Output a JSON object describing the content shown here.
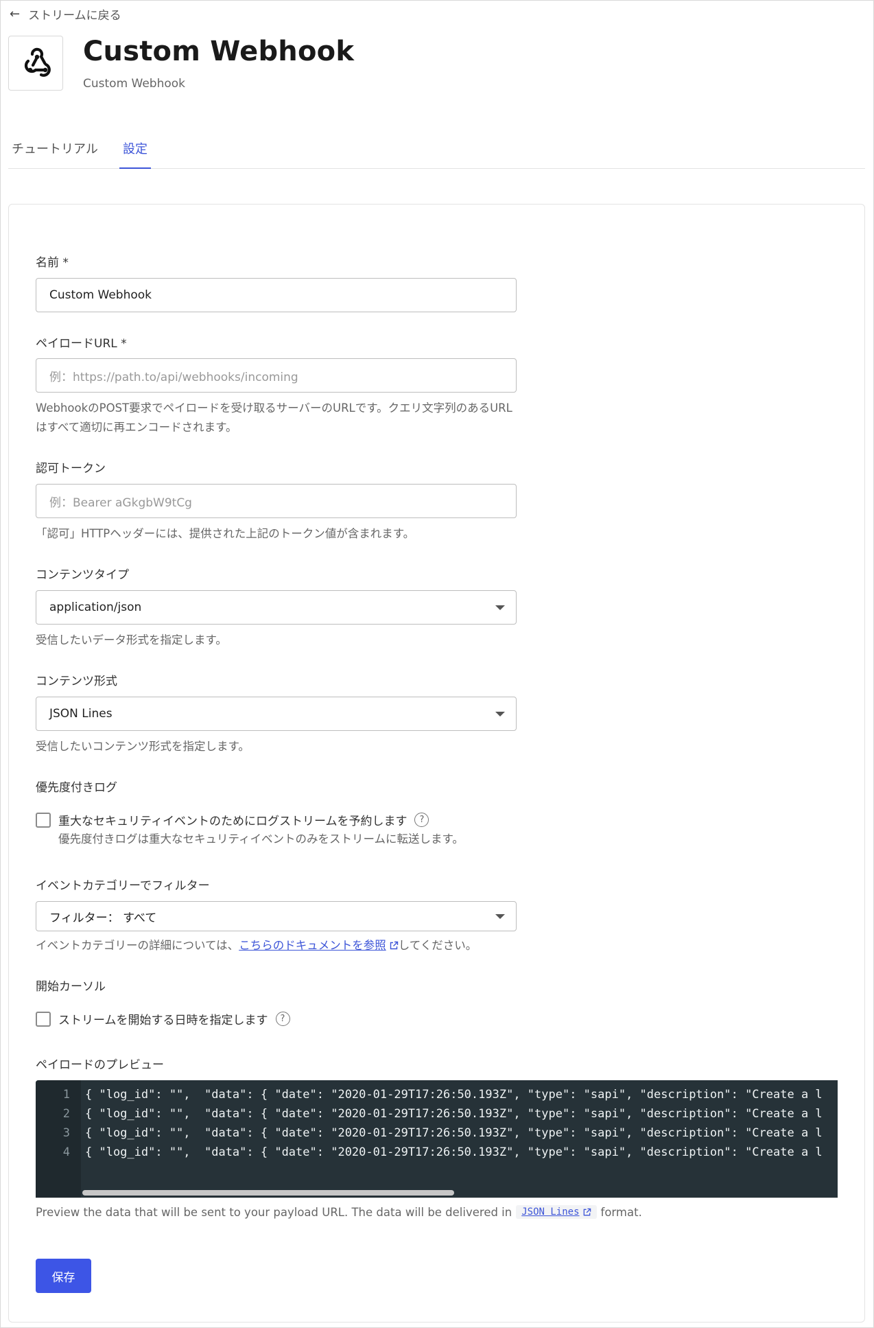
{
  "back_link": {
    "label": "ストリームに戻る",
    "icon": "arrow-left-icon"
  },
  "header": {
    "title": "Custom Webhook",
    "subtitle": "Custom Webhook",
    "logo_icon": "webhook-icon"
  },
  "tabs": [
    {
      "label": "チュートリアル",
      "active": false
    },
    {
      "label": "設定",
      "active": true
    }
  ],
  "form": {
    "name": {
      "label": "名前 *",
      "value": "Custom Webhook"
    },
    "payload_url": {
      "label": "ペイロードURL *",
      "placeholder": "例：https://path.to/api/webhooks/incoming",
      "help": "WebhookのPOST要求でペイロードを受け取るサーバーのURLです。クエリ文字列のあるURLはすべて適切に再エンコードされます。"
    },
    "auth_token": {
      "label": "認可トークン",
      "placeholder": "例：Bearer aGkgbW9tCg",
      "help": "「認可」HTTPヘッダーには、提供された上記のトークン値が含まれます。"
    },
    "content_type": {
      "label": "コンテンツタイプ",
      "value": "application/json",
      "help": "受信したいデータ形式を指定します。"
    },
    "content_format": {
      "label": "コンテンツ形式",
      "value": "JSON Lines",
      "help": "受信したいコンテンツ形式を指定します。"
    },
    "priority_log": {
      "label": "優先度付きログ",
      "checkbox_label": "重大なセキュリティイベントのためにログストリームを予約します",
      "checked": false,
      "help": "優先度付きログは重大なセキュリティイベントのみをストリームに転送します。"
    },
    "event_filter": {
      "label": "イベントカテゴリーでフィルター",
      "value": "フィルター： すべて",
      "help_prefix": "イベントカテゴリーの詳細については、",
      "help_link": "こちらのドキュメントを参照",
      "help_suffix": "してください。"
    },
    "start_cursor": {
      "label": "開始カーソル",
      "checkbox_label": "ストリームを開始する日時を指定します",
      "checked": false
    },
    "preview": {
      "label": "ペイロードのプレビュー",
      "lines": [
        {
          "num": "1",
          "text": "{ \"log_id\": \"\",  \"data\": { \"date\": \"2020-01-29T17:26:50.193Z\", \"type\": \"sapi\", \"description\": \"Create a l"
        },
        {
          "num": "2",
          "text": "{ \"log_id\": \"\",  \"data\": { \"date\": \"2020-01-29T17:26:50.193Z\", \"type\": \"sapi\", \"description\": \"Create a l"
        },
        {
          "num": "3",
          "text": "{ \"log_id\": \"\",  \"data\": { \"date\": \"2020-01-29T17:26:50.193Z\", \"type\": \"sapi\", \"description\": \"Create a l"
        },
        {
          "num": "4",
          "text": "{ \"log_id\": \"\",  \"data\": { \"date\": \"2020-01-29T17:26:50.193Z\", \"type\": \"sapi\", \"description\": \"Create a l"
        }
      ],
      "note_prefix": "Preview the data that will be sent to your payload URL. The data will be delivered in",
      "note_link": "JSON Lines",
      "note_suffix": "format."
    },
    "save_label": "保存"
  },
  "colors": {
    "accent": "#3d55d8",
    "button": "#3d55e6",
    "code_bg": "#263238",
    "code_gutter": "#1f292e"
  }
}
